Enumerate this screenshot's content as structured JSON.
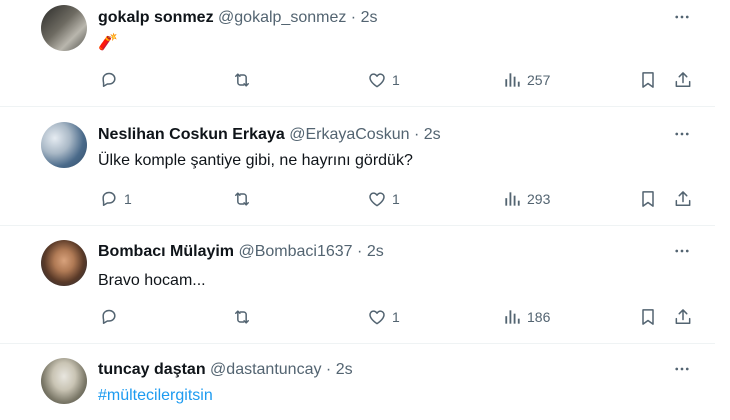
{
  "tweets": [
    {
      "name": "gokalp sonmez",
      "handle": "@gokalp_sonmez",
      "dot": "·",
      "time": "2s",
      "text": "🧨",
      "replies": "",
      "retweets": "",
      "likes": "1",
      "views": "257"
    },
    {
      "name": "Neslihan Coskun Erkaya",
      "handle": "@ErkayaCoskun",
      "dot": "·",
      "time": "2s",
      "text": "Ülke komple şantiye gibi, ne hayrını gördük?",
      "replies": "1",
      "retweets": "",
      "likes": "1",
      "views": "293"
    },
    {
      "name": "Bombacı Mülayim",
      "handle": "@Bombaci1637",
      "dot": "·",
      "time": "2s",
      "text": "Bravo hocam...",
      "replies": "",
      "retweets": "",
      "likes": "1",
      "views": "186"
    },
    {
      "name": "tuncay daştan",
      "handle": "@dastantuncay",
      "dot": "·",
      "time": "2s",
      "text": "#mültecilergitsin"
    }
  ],
  "colors": {
    "text_primary": "#0f1419",
    "text_secondary": "#536471",
    "hashtag": "#1d9bf0",
    "divider": "#eff3f4"
  },
  "icons": {
    "more": "more-horizontal-icon",
    "reply": "reply-icon",
    "retweet": "retweet-icon",
    "like": "heart-icon",
    "views": "views-chart-icon",
    "bookmark": "bookmark-icon",
    "share": "share-icon"
  }
}
